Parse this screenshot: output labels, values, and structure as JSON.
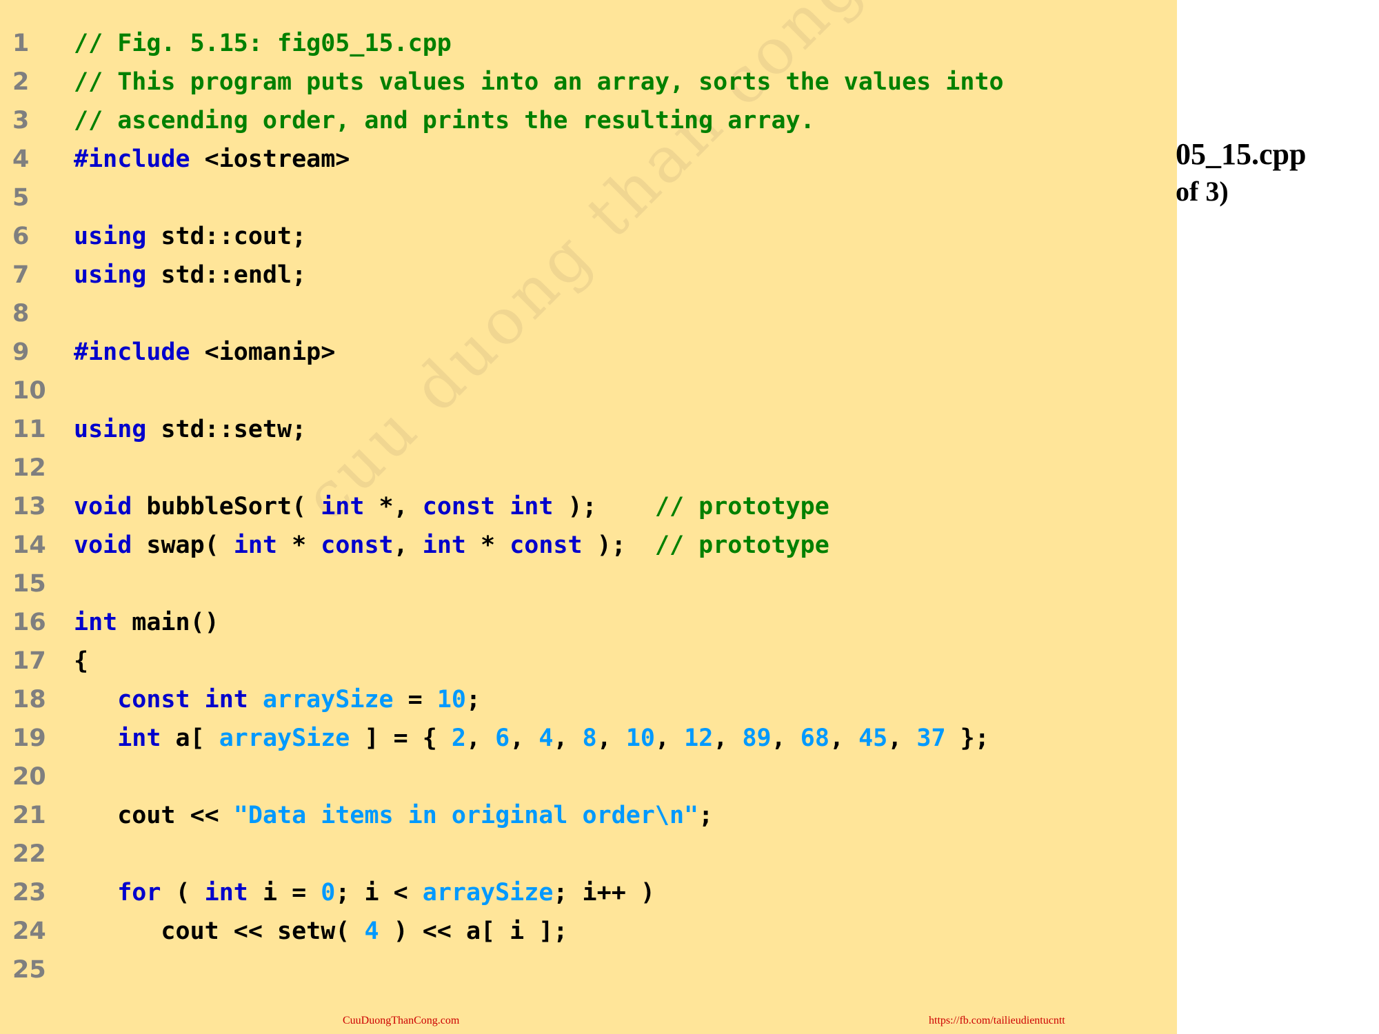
{
  "side_panel": {
    "title_fragment": "05_15.cpp",
    "subtitle_fragment": "of 3)"
  },
  "watermark": "cuu duong than cong . com",
  "footer": {
    "left": "CuuDuongThanCong.com",
    "right": "https://fb.com/tailieudientucntt"
  },
  "colors": {
    "panel_background": "#FFE599",
    "comment": "#008000",
    "keyword": "#0000CC",
    "literal": "#0099FF",
    "plain": "#000000",
    "line_number": "#7f7f7f",
    "footer": "#CC0000"
  },
  "code_lines": [
    {
      "number": "1",
      "tokens": [
        {
          "t": "// Fig. 5.15: fig05_15.cpp",
          "k": "comment"
        }
      ]
    },
    {
      "number": "2",
      "tokens": [
        {
          "t": "// This program puts values into an array, sorts the values into",
          "k": "comment"
        }
      ]
    },
    {
      "number": "3",
      "tokens": [
        {
          "t": "// ascending order, and prints the resulting array.",
          "k": "comment"
        }
      ]
    },
    {
      "number": "4",
      "tokens": [
        {
          "t": "#include",
          "k": "keyword"
        },
        {
          "t": " <iostream>",
          "k": "plain"
        }
      ]
    },
    {
      "number": "5",
      "tokens": []
    },
    {
      "number": "6",
      "tokens": [
        {
          "t": "using",
          "k": "keyword"
        },
        {
          "t": " std::cout;",
          "k": "plain"
        }
      ]
    },
    {
      "number": "7",
      "tokens": [
        {
          "t": "using",
          "k": "keyword"
        },
        {
          "t": " std::endl;",
          "k": "plain"
        }
      ]
    },
    {
      "number": "8",
      "tokens": []
    },
    {
      "number": "9",
      "tokens": [
        {
          "t": "#include",
          "k": "keyword"
        },
        {
          "t": " <iomanip>",
          "k": "plain"
        }
      ]
    },
    {
      "number": "10",
      "tokens": []
    },
    {
      "number": "11",
      "tokens": [
        {
          "t": "using",
          "k": "keyword"
        },
        {
          "t": " std::setw;",
          "k": "plain"
        }
      ]
    },
    {
      "number": "12",
      "tokens": []
    },
    {
      "number": "13",
      "tokens": [
        {
          "t": "void",
          "k": "keyword"
        },
        {
          "t": " bubbleSort( ",
          "k": "plain"
        },
        {
          "t": "int",
          "k": "keyword"
        },
        {
          "t": " *, ",
          "k": "plain"
        },
        {
          "t": "const",
          "k": "keyword"
        },
        {
          "t": " ",
          "k": "plain"
        },
        {
          "t": "int",
          "k": "keyword"
        },
        {
          "t": " );    ",
          "k": "plain"
        },
        {
          "t": "// prototype",
          "k": "comment"
        }
      ]
    },
    {
      "number": "14",
      "tokens": [
        {
          "t": "void",
          "k": "keyword"
        },
        {
          "t": " swap( ",
          "k": "plain"
        },
        {
          "t": "int",
          "k": "keyword"
        },
        {
          "t": " * ",
          "k": "plain"
        },
        {
          "t": "const",
          "k": "keyword"
        },
        {
          "t": ", ",
          "k": "plain"
        },
        {
          "t": "int",
          "k": "keyword"
        },
        {
          "t": " * ",
          "k": "plain"
        },
        {
          "t": "const",
          "k": "keyword"
        },
        {
          "t": " );  ",
          "k": "plain"
        },
        {
          "t": "// prototype",
          "k": "comment"
        }
      ]
    },
    {
      "number": "15",
      "tokens": []
    },
    {
      "number": "16",
      "tokens": [
        {
          "t": "int",
          "k": "keyword"
        },
        {
          "t": " main()",
          "k": "plain"
        }
      ]
    },
    {
      "number": "17",
      "tokens": [
        {
          "t": "{",
          "k": "plain"
        }
      ]
    },
    {
      "number": "18",
      "tokens": [
        {
          "t": "   ",
          "k": "plain"
        },
        {
          "t": "const",
          "k": "keyword"
        },
        {
          "t": " ",
          "k": "plain"
        },
        {
          "t": "int",
          "k": "keyword"
        },
        {
          "t": " ",
          "k": "plain"
        },
        {
          "t": "arraySize",
          "k": "literal"
        },
        {
          "t": " = ",
          "k": "plain"
        },
        {
          "t": "10",
          "k": "literal"
        },
        {
          "t": ";",
          "k": "plain"
        }
      ]
    },
    {
      "number": "19",
      "tokens": [
        {
          "t": "   ",
          "k": "plain"
        },
        {
          "t": "int",
          "k": "keyword"
        },
        {
          "t": " a[ ",
          "k": "plain"
        },
        {
          "t": "arraySize",
          "k": "literal"
        },
        {
          "t": " ] = { ",
          "k": "plain"
        },
        {
          "t": "2",
          "k": "literal"
        },
        {
          "t": ", ",
          "k": "plain"
        },
        {
          "t": "6",
          "k": "literal"
        },
        {
          "t": ", ",
          "k": "plain"
        },
        {
          "t": "4",
          "k": "literal"
        },
        {
          "t": ", ",
          "k": "plain"
        },
        {
          "t": "8",
          "k": "literal"
        },
        {
          "t": ", ",
          "k": "plain"
        },
        {
          "t": "10",
          "k": "literal"
        },
        {
          "t": ", ",
          "k": "plain"
        },
        {
          "t": "12",
          "k": "literal"
        },
        {
          "t": ", ",
          "k": "plain"
        },
        {
          "t": "89",
          "k": "literal"
        },
        {
          "t": ", ",
          "k": "plain"
        },
        {
          "t": "68",
          "k": "literal"
        },
        {
          "t": ", ",
          "k": "plain"
        },
        {
          "t": "45",
          "k": "literal"
        },
        {
          "t": ", ",
          "k": "plain"
        },
        {
          "t": "37",
          "k": "literal"
        },
        {
          "t": " };",
          "k": "plain"
        }
      ]
    },
    {
      "number": "20",
      "tokens": []
    },
    {
      "number": "21",
      "tokens": [
        {
          "t": "   cout << ",
          "k": "plain"
        },
        {
          "t": "\"Data items in original order\\n\"",
          "k": "string"
        },
        {
          "t": ";",
          "k": "plain"
        }
      ]
    },
    {
      "number": "22",
      "tokens": []
    },
    {
      "number": "23",
      "tokens": [
        {
          "t": "   ",
          "k": "plain"
        },
        {
          "t": "for",
          "k": "keyword"
        },
        {
          "t": " ( ",
          "k": "plain"
        },
        {
          "t": "int",
          "k": "keyword"
        },
        {
          "t": " i = ",
          "k": "plain"
        },
        {
          "t": "0",
          "k": "literal"
        },
        {
          "t": "; i < ",
          "k": "plain"
        },
        {
          "t": "arraySize",
          "k": "literal"
        },
        {
          "t": "; i++ )",
          "k": "plain"
        }
      ]
    },
    {
      "number": "24",
      "tokens": [
        {
          "t": "      cout << setw( ",
          "k": "plain"
        },
        {
          "t": "4",
          "k": "literal"
        },
        {
          "t": " ) << a[ i ];",
          "k": "plain"
        }
      ]
    },
    {
      "number": "25",
      "tokens": []
    }
  ]
}
